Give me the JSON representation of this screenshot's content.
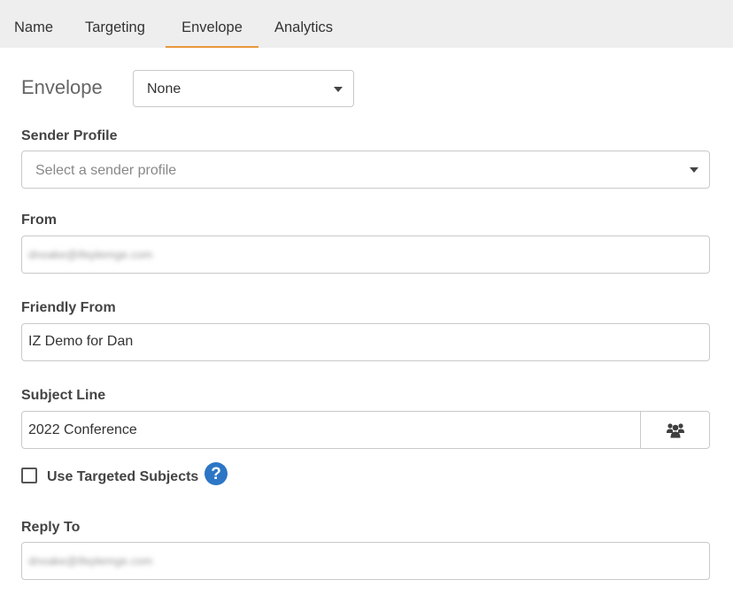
{
  "tabs": [
    {
      "label": "Name"
    },
    {
      "label": "Targeting"
    },
    {
      "label": "Envelope",
      "active": true
    },
    {
      "label": "Analytics"
    }
  ],
  "envelope": {
    "label": "Envelope",
    "selected": "None"
  },
  "sender_profile": {
    "label": "Sender Profile",
    "placeholder": "Select a sender profile"
  },
  "from": {
    "label": "From",
    "value": "dnoake@ifeplemge.com"
  },
  "friendly_from": {
    "label": "Friendly From",
    "value": "IZ Demo for Dan"
  },
  "subject_line": {
    "label": "Subject Line",
    "value": "2022 Conference",
    "button_icon": "users-icon"
  },
  "targeted_subjects": {
    "label": "Use Targeted Subjects",
    "checked": false,
    "help_icon": "question-circle-icon"
  },
  "reply_to": {
    "label": "Reply To",
    "value": "dnoake@ifeplemge.com"
  },
  "colors": {
    "tab_active_underline": "#e8983a",
    "help_icon": "#2c76c5",
    "tabbar_bg": "#eeeeee",
    "border": "#c9c9c9"
  }
}
